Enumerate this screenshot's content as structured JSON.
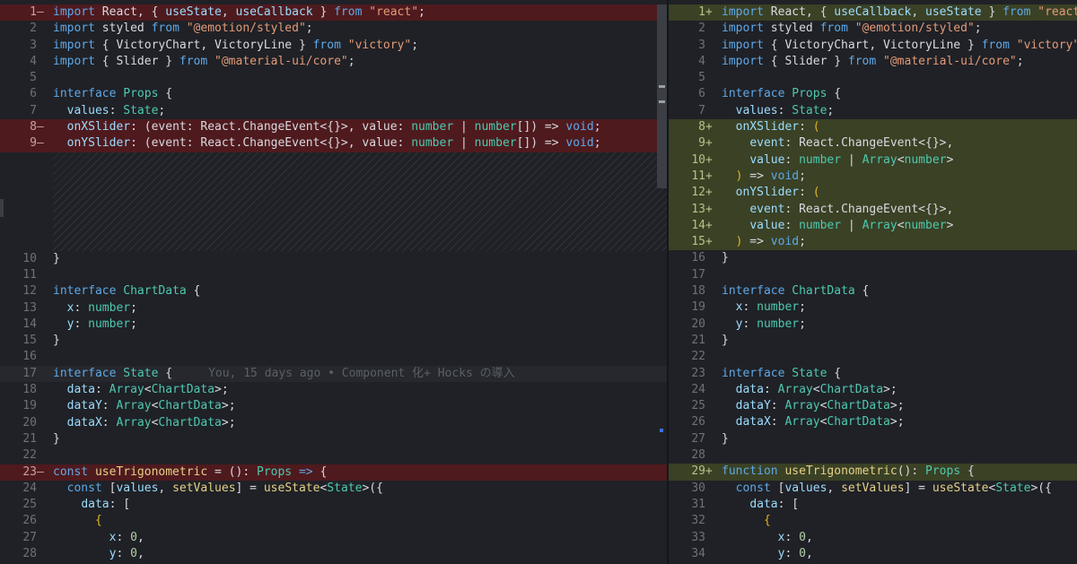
{
  "blame": "You, 15 days ago • Component 化+ Hocks の導入",
  "left": {
    "lines_top": [
      {
        "num": "1",
        "sign": "—",
        "type": "del"
      },
      {
        "num": "2",
        "sign": "",
        "type": ""
      },
      {
        "num": "3",
        "sign": "",
        "type": ""
      },
      {
        "num": "4",
        "sign": "",
        "type": ""
      },
      {
        "num": "5",
        "sign": "",
        "type": ""
      },
      {
        "num": "6",
        "sign": "",
        "type": ""
      },
      {
        "num": "7",
        "sign": "",
        "type": ""
      },
      {
        "num": "8",
        "sign": "—",
        "type": "del"
      },
      {
        "num": "9",
        "sign": "—",
        "type": "del"
      }
    ],
    "lines_bottom": [
      {
        "num": "10",
        "sign": "",
        "type": ""
      },
      {
        "num": "11",
        "sign": "",
        "type": ""
      },
      {
        "num": "12",
        "sign": "",
        "type": ""
      },
      {
        "num": "13",
        "sign": "",
        "type": ""
      },
      {
        "num": "14",
        "sign": "",
        "type": ""
      },
      {
        "num": "15",
        "sign": "",
        "type": ""
      },
      {
        "num": "16",
        "sign": "",
        "type": ""
      },
      {
        "num": "17",
        "sign": "",
        "type": ""
      },
      {
        "num": "18",
        "sign": "",
        "type": ""
      },
      {
        "num": "19",
        "sign": "",
        "type": ""
      },
      {
        "num": "20",
        "sign": "",
        "type": ""
      },
      {
        "num": "21",
        "sign": "",
        "type": ""
      },
      {
        "num": "22",
        "sign": "",
        "type": ""
      },
      {
        "num": "23",
        "sign": "—",
        "type": "del"
      },
      {
        "num": "24",
        "sign": "",
        "type": ""
      },
      {
        "num": "25",
        "sign": "",
        "type": ""
      },
      {
        "num": "26",
        "sign": "",
        "type": ""
      },
      {
        "num": "27",
        "sign": "",
        "type": ""
      },
      {
        "num": "28",
        "sign": "",
        "type": ""
      }
    ]
  },
  "right": {
    "lines": [
      {
        "num": "1",
        "sign": "+",
        "type": "add"
      },
      {
        "num": "2",
        "sign": "",
        "type": ""
      },
      {
        "num": "3",
        "sign": "",
        "type": ""
      },
      {
        "num": "4",
        "sign": "",
        "type": ""
      },
      {
        "num": "5",
        "sign": "",
        "type": ""
      },
      {
        "num": "6",
        "sign": "",
        "type": ""
      },
      {
        "num": "7",
        "sign": "",
        "type": ""
      },
      {
        "num": "8",
        "sign": "+",
        "type": "add"
      },
      {
        "num": "9",
        "sign": "+",
        "type": "add"
      },
      {
        "num": "10",
        "sign": "+",
        "type": "add"
      },
      {
        "num": "11",
        "sign": "+",
        "type": "add"
      },
      {
        "num": "12",
        "sign": "+",
        "type": "add"
      },
      {
        "num": "13",
        "sign": "+",
        "type": "add"
      },
      {
        "num": "14",
        "sign": "+",
        "type": "add"
      },
      {
        "num": "15",
        "sign": "+",
        "type": "add"
      },
      {
        "num": "16",
        "sign": "",
        "type": ""
      },
      {
        "num": "17",
        "sign": "",
        "type": ""
      },
      {
        "num": "18",
        "sign": "",
        "type": ""
      },
      {
        "num": "19",
        "sign": "",
        "type": ""
      },
      {
        "num": "20",
        "sign": "",
        "type": ""
      },
      {
        "num": "21",
        "sign": "",
        "type": ""
      },
      {
        "num": "22",
        "sign": "",
        "type": ""
      },
      {
        "num": "23",
        "sign": "",
        "type": ""
      },
      {
        "num": "24",
        "sign": "",
        "type": ""
      },
      {
        "num": "25",
        "sign": "",
        "type": ""
      },
      {
        "num": "26",
        "sign": "",
        "type": ""
      },
      {
        "num": "27",
        "sign": "",
        "type": ""
      },
      {
        "num": "28",
        "sign": "",
        "type": ""
      },
      {
        "num": "29",
        "sign": "+",
        "type": "add"
      },
      {
        "num": "30",
        "sign": "",
        "type": ""
      },
      {
        "num": "31",
        "sign": "",
        "type": ""
      },
      {
        "num": "32",
        "sign": "",
        "type": ""
      },
      {
        "num": "33",
        "sign": "",
        "type": ""
      },
      {
        "num": "34",
        "sign": "",
        "type": ""
      }
    ]
  },
  "left_code_top": [
    [
      [
        "kw",
        "import"
      ],
      [
        "op",
        " React, { "
      ],
      [
        "prop",
        "useState"
      ],
      [
        "op",
        ", "
      ],
      [
        "prop",
        "useCallback"
      ],
      [
        "op",
        " } "
      ],
      [
        "kw",
        "from"
      ],
      [
        "op",
        " "
      ],
      [
        "str",
        "\"react\""
      ],
      [
        "op",
        ";"
      ]
    ],
    [
      [
        "kw",
        "import"
      ],
      [
        "op",
        " styled "
      ],
      [
        "kw",
        "from"
      ],
      [
        "op",
        " "
      ],
      [
        "str",
        "\"@emotion/styled\""
      ],
      [
        "op",
        ";"
      ]
    ],
    [
      [
        "kw",
        "import"
      ],
      [
        "op",
        " { VictoryChart, VictoryLine } "
      ],
      [
        "kw",
        "from"
      ],
      [
        "op",
        " "
      ],
      [
        "str",
        "\"victory\""
      ],
      [
        "op",
        ";"
      ]
    ],
    [
      [
        "kw",
        "import"
      ],
      [
        "op",
        " { Slider } "
      ],
      [
        "kw",
        "from"
      ],
      [
        "op",
        " "
      ],
      [
        "str",
        "\"@material-ui/core\""
      ],
      [
        "op",
        ";"
      ]
    ],
    [],
    [
      [
        "kw",
        "interface"
      ],
      [
        "op",
        " "
      ],
      [
        "ty",
        "Props"
      ],
      [
        "op",
        " {"
      ]
    ],
    [
      [
        "op",
        "  "
      ],
      [
        "prop",
        "values"
      ],
      [
        "op",
        ": "
      ],
      [
        "ty",
        "State"
      ],
      [
        "op",
        ";"
      ]
    ],
    [
      [
        "op",
        "  "
      ],
      [
        "prop",
        "onXSlider"
      ],
      [
        "op",
        ": (event: React.ChangeEvent<{}>, value: "
      ],
      [
        "ty",
        "number"
      ],
      [
        "op",
        " | "
      ],
      [
        "ty",
        "number"
      ],
      [
        "op",
        "[]) => "
      ],
      [
        "kw",
        "void"
      ],
      [
        "op",
        ";"
      ]
    ],
    [
      [
        "op",
        "  "
      ],
      [
        "prop",
        "onYSlider"
      ],
      [
        "op",
        ": (event: React.ChangeEvent<{}>, value: "
      ],
      [
        "ty",
        "number"
      ],
      [
        "op",
        " | "
      ],
      [
        "ty",
        "number"
      ],
      [
        "op",
        "[]) => "
      ],
      [
        "kw",
        "void"
      ],
      [
        "op",
        ";"
      ]
    ]
  ],
  "left_code_bottom": [
    [
      [
        "op",
        "}"
      ]
    ],
    [],
    [
      [
        "kw",
        "interface"
      ],
      [
        "op",
        " "
      ],
      [
        "ty",
        "ChartData"
      ],
      [
        "op",
        " {"
      ]
    ],
    [
      [
        "op",
        "  "
      ],
      [
        "prop",
        "x"
      ],
      [
        "op",
        ": "
      ],
      [
        "ty",
        "number"
      ],
      [
        "op",
        ";"
      ]
    ],
    [
      [
        "op",
        "  "
      ],
      [
        "prop",
        "y"
      ],
      [
        "op",
        ": "
      ],
      [
        "ty",
        "number"
      ],
      [
        "op",
        ";"
      ]
    ],
    [
      [
        "op",
        "}"
      ]
    ],
    [],
    [
      [
        "kw",
        "interface"
      ],
      [
        "op",
        " "
      ],
      [
        "ty",
        "State"
      ],
      [
        "op",
        " {"
      ]
    ],
    [
      [
        "op",
        "  "
      ],
      [
        "prop",
        "data"
      ],
      [
        "op",
        ": "
      ],
      [
        "ty",
        "Array"
      ],
      [
        "op",
        "<"
      ],
      [
        "ty",
        "ChartData"
      ],
      [
        "op",
        ">;"
      ]
    ],
    [
      [
        "op",
        "  "
      ],
      [
        "prop",
        "dataY"
      ],
      [
        "op",
        ": "
      ],
      [
        "ty",
        "Array"
      ],
      [
        "op",
        "<"
      ],
      [
        "ty",
        "ChartData"
      ],
      [
        "op",
        ">;"
      ]
    ],
    [
      [
        "op",
        "  "
      ],
      [
        "prop",
        "dataX"
      ],
      [
        "op",
        ": "
      ],
      [
        "ty",
        "Array"
      ],
      [
        "op",
        "<"
      ],
      [
        "ty",
        "ChartData"
      ],
      [
        "op",
        ">;"
      ]
    ],
    [
      [
        "op",
        "}"
      ]
    ],
    [],
    [
      [
        "kw",
        "const"
      ],
      [
        "op",
        " "
      ],
      [
        "fn",
        "useTrigonometric"
      ],
      [
        "op",
        " = (): "
      ],
      [
        "ty",
        "Props"
      ],
      [
        "op",
        " "
      ],
      [
        "kw",
        "=>"
      ],
      [
        "op",
        " {"
      ]
    ],
    [
      [
        "op",
        "  "
      ],
      [
        "kw",
        "const"
      ],
      [
        "op",
        " ["
      ],
      [
        "prop",
        "values"
      ],
      [
        "op",
        ", "
      ],
      [
        "fn",
        "setValues"
      ],
      [
        "op",
        "] = "
      ],
      [
        "fn",
        "useState"
      ],
      [
        "op",
        "<"
      ],
      [
        "ty",
        "State"
      ],
      [
        "op",
        ">({"
      ]
    ],
    [
      [
        "op",
        "    "
      ],
      [
        "prop",
        "data"
      ],
      [
        "op",
        ": ["
      ]
    ],
    [
      [
        "op",
        "      "
      ],
      [
        "br1",
        "{"
      ]
    ],
    [
      [
        "op",
        "        "
      ],
      [
        "prop",
        "x"
      ],
      [
        "op",
        ": "
      ],
      [
        "num",
        "0"
      ],
      [
        "op",
        ","
      ]
    ],
    [
      [
        "op",
        "        "
      ],
      [
        "prop",
        "y"
      ],
      [
        "op",
        ": "
      ],
      [
        "num",
        "0"
      ],
      [
        "op",
        ","
      ]
    ]
  ],
  "right_code": [
    [
      [
        "kw",
        "import"
      ],
      [
        "op",
        " React, { "
      ],
      [
        "prop",
        "useCallback"
      ],
      [
        "op",
        ", "
      ],
      [
        "prop",
        "useState"
      ],
      [
        "op",
        " } "
      ],
      [
        "kw",
        "from"
      ],
      [
        "op",
        " "
      ],
      [
        "str",
        "\"react\""
      ],
      [
        "op",
        ";"
      ]
    ],
    [
      [
        "kw",
        "import"
      ],
      [
        "op",
        " styled "
      ],
      [
        "kw",
        "from"
      ],
      [
        "op",
        " "
      ],
      [
        "str",
        "\"@emotion/styled\""
      ],
      [
        "op",
        ";"
      ]
    ],
    [
      [
        "kw",
        "import"
      ],
      [
        "op",
        " { VictoryChart, VictoryLine } "
      ],
      [
        "kw",
        "from"
      ],
      [
        "op",
        " "
      ],
      [
        "str",
        "\"victory\""
      ],
      [
        "op",
        ";"
      ]
    ],
    [
      [
        "kw",
        "import"
      ],
      [
        "op",
        " { Slider } "
      ],
      [
        "kw",
        "from"
      ],
      [
        "op",
        " "
      ],
      [
        "str",
        "\"@material-ui/core\""
      ],
      [
        "op",
        ";"
      ]
    ],
    [],
    [
      [
        "kw",
        "interface"
      ],
      [
        "op",
        " "
      ],
      [
        "ty",
        "Props"
      ],
      [
        "op",
        " {"
      ]
    ],
    [
      [
        "op",
        "  "
      ],
      [
        "prop",
        "values"
      ],
      [
        "op",
        ": "
      ],
      [
        "ty",
        "State"
      ],
      [
        "op",
        ";"
      ]
    ],
    [
      [
        "op",
        "  "
      ],
      [
        "prop",
        "onXSlider"
      ],
      [
        "op",
        ": "
      ],
      [
        "br1",
        "("
      ]
    ],
    [
      [
        "op",
        "    "
      ],
      [
        "prop",
        "event"
      ],
      [
        "op",
        ": React.ChangeEvent<{}>,"
      ]
    ],
    [
      [
        "op",
        "    "
      ],
      [
        "prop",
        "value"
      ],
      [
        "op",
        ": "
      ],
      [
        "ty",
        "number"
      ],
      [
        "op",
        " | "
      ],
      [
        "ty",
        "Array"
      ],
      [
        "op",
        "<"
      ],
      [
        "ty",
        "number"
      ],
      [
        "op",
        ">"
      ]
    ],
    [
      [
        "op",
        "  "
      ],
      [
        "br1",
        ")"
      ],
      [
        "op",
        " => "
      ],
      [
        "kw",
        "void"
      ],
      [
        "op",
        ";"
      ]
    ],
    [
      [
        "op",
        "  "
      ],
      [
        "prop",
        "onYSlider"
      ],
      [
        "op",
        ": "
      ],
      [
        "br1",
        "("
      ]
    ],
    [
      [
        "op",
        "    "
      ],
      [
        "prop",
        "event"
      ],
      [
        "op",
        ": React.ChangeEvent<{}>,"
      ]
    ],
    [
      [
        "op",
        "    "
      ],
      [
        "prop",
        "value"
      ],
      [
        "op",
        ": "
      ],
      [
        "ty",
        "number"
      ],
      [
        "op",
        " | "
      ],
      [
        "ty",
        "Array"
      ],
      [
        "op",
        "<"
      ],
      [
        "ty",
        "number"
      ],
      [
        "op",
        ">"
      ]
    ],
    [
      [
        "op",
        "  "
      ],
      [
        "br1",
        ")"
      ],
      [
        "op",
        " => "
      ],
      [
        "kw",
        "void"
      ],
      [
        "op",
        ";"
      ]
    ],
    [
      [
        "op",
        "}"
      ]
    ],
    [],
    [
      [
        "kw",
        "interface"
      ],
      [
        "op",
        " "
      ],
      [
        "ty",
        "ChartData"
      ],
      [
        "op",
        " {"
      ]
    ],
    [
      [
        "op",
        "  "
      ],
      [
        "prop",
        "x"
      ],
      [
        "op",
        ": "
      ],
      [
        "ty",
        "number"
      ],
      [
        "op",
        ";"
      ]
    ],
    [
      [
        "op",
        "  "
      ],
      [
        "prop",
        "y"
      ],
      [
        "op",
        ": "
      ],
      [
        "ty",
        "number"
      ],
      [
        "op",
        ";"
      ]
    ],
    [
      [
        "op",
        "}"
      ]
    ],
    [],
    [
      [
        "kw",
        "interface"
      ],
      [
        "op",
        " "
      ],
      [
        "ty",
        "State"
      ],
      [
        "op",
        " {"
      ]
    ],
    [
      [
        "op",
        "  "
      ],
      [
        "prop",
        "data"
      ],
      [
        "op",
        ": "
      ],
      [
        "ty",
        "Array"
      ],
      [
        "op",
        "<"
      ],
      [
        "ty",
        "ChartData"
      ],
      [
        "op",
        ">;"
      ]
    ],
    [
      [
        "op",
        "  "
      ],
      [
        "prop",
        "dataY"
      ],
      [
        "op",
        ": "
      ],
      [
        "ty",
        "Array"
      ],
      [
        "op",
        "<"
      ],
      [
        "ty",
        "ChartData"
      ],
      [
        "op",
        ">;"
      ]
    ],
    [
      [
        "op",
        "  "
      ],
      [
        "prop",
        "dataX"
      ],
      [
        "op",
        ": "
      ],
      [
        "ty",
        "Array"
      ],
      [
        "op",
        "<"
      ],
      [
        "ty",
        "ChartData"
      ],
      [
        "op",
        ">;"
      ]
    ],
    [
      [
        "op",
        "}"
      ]
    ],
    [],
    [
      [
        "kw",
        "function"
      ],
      [
        "op",
        " "
      ],
      [
        "fn",
        "useTrigonometric"
      ],
      [
        "op",
        "(): "
      ],
      [
        "ty",
        "Props"
      ],
      [
        "op",
        " {"
      ]
    ],
    [
      [
        "op",
        "  "
      ],
      [
        "kw",
        "const"
      ],
      [
        "op",
        " ["
      ],
      [
        "prop",
        "values"
      ],
      [
        "op",
        ", "
      ],
      [
        "fn",
        "setValues"
      ],
      [
        "op",
        "] = "
      ],
      [
        "fn",
        "useState"
      ],
      [
        "op",
        "<"
      ],
      [
        "ty",
        "State"
      ],
      [
        "op",
        ">({"
      ]
    ],
    [
      [
        "op",
        "    "
      ],
      [
        "prop",
        "data"
      ],
      [
        "op",
        ": ["
      ]
    ],
    [
      [
        "op",
        "      "
      ],
      [
        "br1",
        "{"
      ]
    ],
    [
      [
        "op",
        "        "
      ],
      [
        "prop",
        "x"
      ],
      [
        "op",
        ": "
      ],
      [
        "num",
        "0"
      ],
      [
        "op",
        ","
      ]
    ],
    [
      [
        "op",
        "        "
      ],
      [
        "prop",
        "y"
      ],
      [
        "op",
        ": "
      ],
      [
        "num",
        "0"
      ],
      [
        "op",
        ","
      ]
    ]
  ]
}
